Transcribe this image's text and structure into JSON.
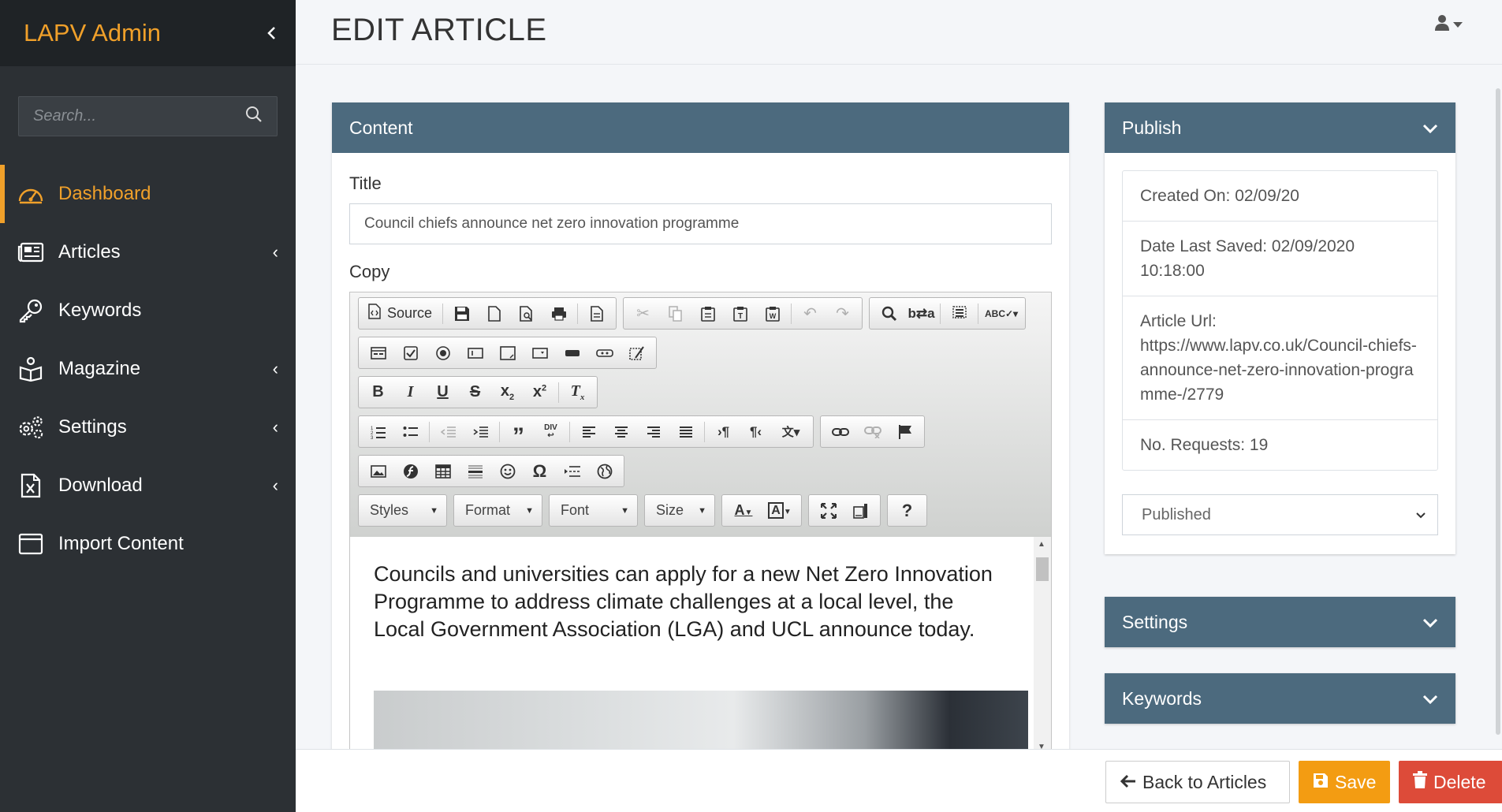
{
  "app": {
    "brand": "LAPV Admin"
  },
  "search": {
    "placeholder": "Search..."
  },
  "nav": {
    "items": [
      {
        "label": "Dashboard",
        "icon": "dashboard-icon",
        "active": true,
        "caret": false
      },
      {
        "label": "Articles",
        "icon": "newspaper-icon",
        "caret": true
      },
      {
        "label": "Keywords",
        "icon": "key-icon",
        "caret": false
      },
      {
        "label": "Magazine",
        "icon": "book-reader-icon",
        "caret": true
      },
      {
        "label": "Settings",
        "icon": "cogs-icon",
        "caret": true
      },
      {
        "label": "Download",
        "icon": "file-excel-icon",
        "caret": true
      },
      {
        "label": "Import Content",
        "icon": "window-icon",
        "caret": false
      }
    ]
  },
  "page": {
    "title": "EDIT ARTICLE"
  },
  "content_panel": {
    "header": "Content",
    "title_label": "Title",
    "title_value": "Council chiefs announce net zero innovation programme",
    "copy_label": "Copy"
  },
  "editor": {
    "source_label": "Source",
    "combos": {
      "styles": "Styles",
      "format": "Format",
      "font": "Font",
      "size": "Size"
    },
    "body_text": "Councils and universities can apply for a new Net Zero Innovation Programme to address climate challenges at a local level, the Local Government Association (LGA) and UCL announce today."
  },
  "publish": {
    "header": "Publish",
    "created": "Created On: 02/09/20",
    "last_saved": "Date Last Saved: 02/09/2020 10:18:00",
    "url_label": "Article Url:",
    "url_value": "https://www.lapv.co.uk/Council-chiefs-announce-net-zero-innovation-programme-/2779",
    "requests": "No. Requests: 19",
    "status": "Published"
  },
  "settings_panel": {
    "header": "Settings"
  },
  "keywords_panel": {
    "header": "Keywords"
  },
  "footer": {
    "back": "Back to Articles",
    "save": "Save",
    "delete": "Delete"
  },
  "colors": {
    "accent": "#f0a02a",
    "panel_header": "#4c6a7e",
    "sidebar": "#2c3034",
    "save": "#f39c12",
    "delete": "#dd4b39"
  }
}
